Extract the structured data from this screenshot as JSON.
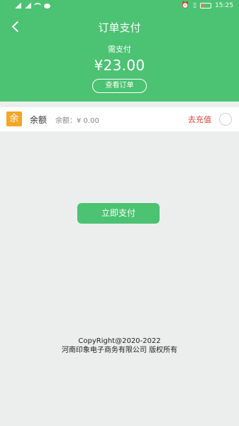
{
  "status_bar": {
    "time": "15:25",
    "left_icons": [
      "signal-icon",
      "signal-icon",
      "wifi-icon",
      "sim-icon",
      "chat-icon"
    ],
    "right_icons": [
      "alarm-icon",
      "vibrate-icon",
      "battery-icon"
    ]
  },
  "header": {
    "title": "订单支付",
    "need_pay_label": "需支付",
    "amount": "¥23.00",
    "view_order_label": "查看订单",
    "background": "#4cc273"
  },
  "balance": {
    "icon_text": "余",
    "label": "余额",
    "value_text": "余额：¥ 0.00",
    "recharge_label": "去充值"
  },
  "pay_button": {
    "label": "立即支付"
  },
  "footer": {
    "copyright": "CopyRight@2020-2022",
    "company": "河南印象电子商务有限公司 版权所有"
  }
}
